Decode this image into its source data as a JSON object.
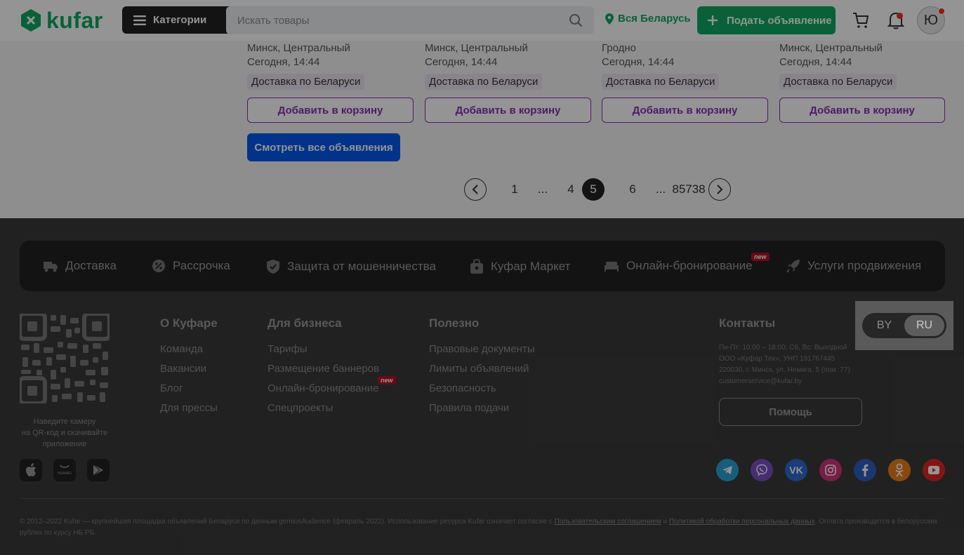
{
  "header": {
    "logo_text": "kufar",
    "categories_label": "Категории",
    "search_placeholder": "Искать товары",
    "location_label": "Вся Беларусь",
    "post_ad_label": "Подать объявление",
    "avatar_letter": "Ю"
  },
  "listings": [
    {
      "location": "Минск, Центральный",
      "time": "Сегодня, 14:44",
      "badge": "Доставка по Беларуси",
      "add_label": "Добавить в корзину"
    },
    {
      "location": "Минск, Центральный",
      "time": "Сегодня, 14:44",
      "badge": "Доставка по Беларуси",
      "add_label": "Добавить в корзину"
    },
    {
      "location": "Гродно",
      "time": "Сегодня, 14:44",
      "badge": "Доставка по Беларуси",
      "add_label": "Добавить в корзину"
    },
    {
      "location": "Минск, Центральный",
      "time": "Сегодня, 14:44",
      "badge": "Доставка по Беларуси",
      "add_label": "Добавить в корзину"
    }
  ],
  "view_all_label": "Смотреть все объявления",
  "pagination": {
    "pages": [
      "1",
      "...",
      "4",
      "5",
      "6",
      "...",
      "85738"
    ],
    "current": "5"
  },
  "services": [
    {
      "label": "Доставка",
      "icon": "truck-icon"
    },
    {
      "label": "Рассрочка",
      "icon": "percent-icon"
    },
    {
      "label": "Защита от мошенничества",
      "icon": "shield-icon"
    },
    {
      "label": "Куфар Маркет",
      "icon": "bag-icon"
    },
    {
      "label": "Онлайн-бронирование",
      "icon": "bed-icon",
      "badge": "new"
    },
    {
      "label": "Услуги продвижения",
      "icon": "rocket-icon"
    }
  ],
  "qr_caption": [
    "Наведите камеру",
    "на QR-код и скачивайте",
    "приложение"
  ],
  "stores": [
    "apple-icon",
    "huawei-icon",
    "google-play-icon"
  ],
  "huawei_text": "HUAWEI",
  "footer_columns": [
    {
      "title": "О Куфаре",
      "links": [
        "Команда",
        "Вакансии",
        "Блог",
        "Для прессы"
      ]
    },
    {
      "title": "Для бизнеса",
      "links": [
        "Тарифы",
        "Размещение баннеров",
        "Онлайн-бронирование",
        "Спецпроекты"
      ],
      "new_badge": "new"
    },
    {
      "title": "Полезно",
      "links": [
        "Правовые документы",
        "Лимиты объявлений",
        "Безопасность",
        "Правила подачи"
      ]
    }
  ],
  "contacts": {
    "title": "Контакты",
    "lines": [
      "Пн-Пт: 10:00 – 18:00; Сб, Вс: Выходной",
      "ООО «Куфар Тех», УНП 191767445",
      "220030, г. Минск, ул. Немига, 5 (пом. 77)",
      "customerservice@kufar.by"
    ],
    "help_label": "Помощь"
  },
  "language": {
    "options": [
      "BY",
      "RU"
    ],
    "selected": "RU"
  },
  "social": [
    {
      "name": "telegram-icon",
      "color": "#2aa3d6"
    },
    {
      "name": "viber-icon",
      "color": "#7d4fc7"
    },
    {
      "name": "vk-icon",
      "color": "#2f6ad1"
    },
    {
      "name": "instagram-icon",
      "color": "#d13479"
    },
    {
      "name": "facebook-icon",
      "color": "#2d5fc4"
    },
    {
      "name": "odnoklassniki-icon",
      "color": "#ee7f16"
    },
    {
      "name": "youtube-icon",
      "color": "#e32525"
    }
  ],
  "copyright": {
    "prefix": "© 2012–2022 Kufar — крупнейшая площадка объявлений Беларуси по данным gemiusAudience (февраль 2022). Использование ресурса Kufar означает согласие с ",
    "link1": "Пользовательским соглашением",
    "middle": " и ",
    "link2": "Политикой обработки персональных данных",
    "suffix": ". Оплата производится в белорусских рублях по курсу НБ РБ."
  },
  "colors": {
    "brand": "#0ea861",
    "accent_purple": "#8a2cb7",
    "button_blue": "#0558ee"
  }
}
